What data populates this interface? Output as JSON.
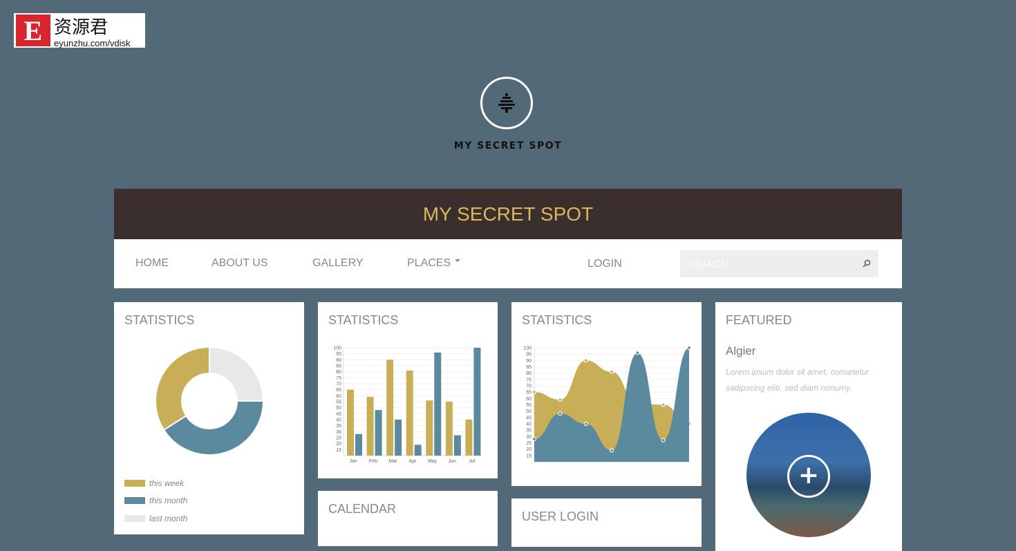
{
  "watermark": {
    "logo_letter": "E",
    "chinese": "资源君",
    "url": "eyunzhu.com/vdisk"
  },
  "brand": {
    "name": "MY SECRET SPOT",
    "icon": "tree-icon"
  },
  "header": {
    "title": "MY SECRET SPOT"
  },
  "nav": {
    "items": [
      "HOME",
      "ABOUT US",
      "GALLERY",
      "PLACES"
    ],
    "login": "LOGIN",
    "search_placeholder": "SEARCH"
  },
  "colors": {
    "gold": "#c9ae58",
    "blue": "#5b8a9f",
    "gray": "#e8e8e8",
    "header_bg": "#3a2f2d",
    "header_text": "#d9b85c",
    "page_bg": "#526a77"
  },
  "cards": {
    "stats1": "STATISTICS",
    "stats2": "STATISTICS",
    "stats3": "STATISTICS",
    "featured": "FEATURED",
    "calendar": "CALENDAR",
    "user_login": "USER LOGIN"
  },
  "featured": {
    "place": "Algier",
    "text": "Lorem ipsum dolor sit amet, consetetur sadipscing elitr, sed diam nonumy.",
    "action_icon": "plus-icon"
  },
  "chart_data": [
    {
      "type": "pie",
      "donut": true,
      "series": [
        {
          "name": "this week",
          "value": 34
        },
        {
          "name": "this month",
          "value": 41
        },
        {
          "name": "last month",
          "value": 25
        }
      ],
      "legend": "bottom"
    },
    {
      "type": "bar",
      "categories": [
        "Jan",
        "Feb",
        "Mar",
        "Apr",
        "May",
        "Jun",
        "Jul"
      ],
      "series": [
        {
          "values": [
            65,
            59,
            90,
            81,
            56,
            55,
            40
          ]
        },
        {
          "values": [
            28,
            48,
            40,
            19,
            96,
            27,
            100
          ]
        }
      ],
      "ylim": [
        10,
        100
      ],
      "yticks": [
        15,
        20,
        25,
        30,
        35,
        40,
        45,
        50,
        55,
        60,
        65,
        70,
        75,
        80,
        85,
        90,
        95,
        100
      ],
      "grid": true
    },
    {
      "type": "area",
      "categories": [
        "",
        "",
        "",
        "",
        "",
        "",
        ""
      ],
      "series": [
        {
          "values": [
            65,
            59,
            90,
            81,
            56,
            55,
            40
          ]
        },
        {
          "values": [
            28,
            48,
            40,
            19,
            96,
            27,
            100
          ]
        }
      ],
      "ylim": [
        10,
        100
      ],
      "yticks": [
        15,
        20,
        25,
        30,
        35,
        40,
        45,
        50,
        55,
        60,
        65,
        70,
        75,
        80,
        85,
        90,
        95,
        100
      ],
      "grid": true
    }
  ]
}
